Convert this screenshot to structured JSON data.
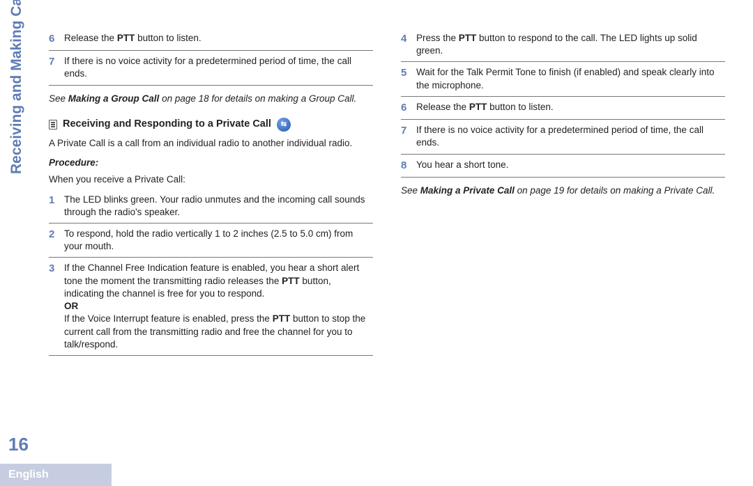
{
  "sidebar": {
    "title": "Receiving and Making Calls"
  },
  "page_number": "16",
  "footer": "English",
  "left": {
    "pre_steps": [
      {
        "num": "6",
        "body_parts": [
          "Release the ",
          "PTT",
          " button to listen."
        ]
      },
      {
        "num": "7",
        "body_parts": [
          "If there is no voice activity for a predetermined period of time, the call ends."
        ]
      }
    ],
    "note_parts": [
      "See ",
      "Making a Group Call",
      " on page 18 for details on making a Group Call."
    ],
    "subheading": "Receiving and Responding to a Private Call",
    "intro": "A Private Call is a call from an individual radio to another individual radio.",
    "procedure_label": "Procedure:",
    "intro2": "When you receive a Private Call:",
    "steps": [
      {
        "num": "1",
        "body_parts": [
          "The LED blinks green. Your radio unmutes and the incoming call sounds through the radio's speaker."
        ]
      },
      {
        "num": "2",
        "body_parts": [
          "To respond, hold the radio vertically 1 to 2 inches (2.5 to 5.0 cm) from your mouth."
        ]
      },
      {
        "num": "3",
        "body_parts": [
          "If the Channel Free Indication feature is enabled, you hear a short alert tone the moment the transmitting radio releases the ",
          "PTT",
          " button, indicating the channel is free for you to respond."
        ],
        "or": "OR",
        "body2_parts": [
          "If the Voice Interrupt feature is enabled, press the ",
          "PTT",
          " button to stop the current call from the transmitting radio and free the channel for you to talk/respond."
        ]
      }
    ]
  },
  "right": {
    "steps": [
      {
        "num": "4",
        "body_parts": [
          "Press the ",
          "PTT",
          " button to respond to the call. The LED lights up solid green."
        ]
      },
      {
        "num": "5",
        "body_parts": [
          "Wait for the Talk Permit Tone to finish (if enabled) and speak clearly into the microphone."
        ]
      },
      {
        "num": "6",
        "body_parts": [
          "Release the ",
          "PTT",
          " button to listen."
        ]
      },
      {
        "num": "7",
        "body_parts": [
          "If there is no voice activity for a predetermined period of time, the call ends."
        ]
      },
      {
        "num": "8",
        "body_parts": [
          "You hear a short tone."
        ]
      }
    ],
    "note_parts": [
      "See ",
      "Making a Private Call",
      " on page 19 for details on making a Private Call."
    ]
  },
  "circle_icon_glyph": "⇆"
}
